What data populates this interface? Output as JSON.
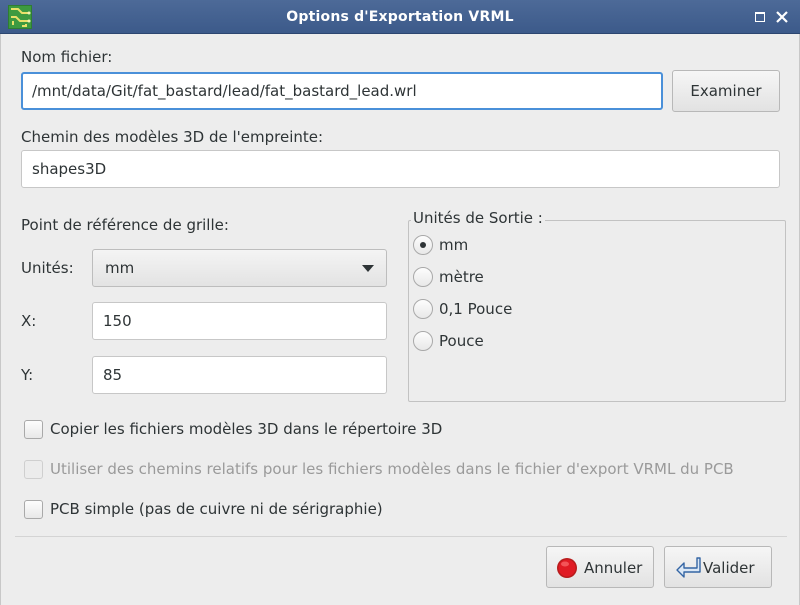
{
  "window": {
    "title": "Options d'Exportation VRML"
  },
  "file": {
    "label": "Nom fichier:",
    "value": "/mnt/data/Git/fat_bastard/lead/fat_bastard_lead.wrl",
    "browse_label": "Examiner"
  },
  "models_path": {
    "label": "Chemin des modèles 3D de l'empreinte:",
    "value": "shapes3D"
  },
  "grid_ref": {
    "label": "Point de référence de grille:",
    "units_label": "Unités:",
    "units_value": "mm",
    "x_label": "X:",
    "x_value": "150",
    "y_label": "Y:",
    "y_value": "85"
  },
  "output_units": {
    "title": "Unités de Sortie :",
    "options": [
      {
        "label": "mm",
        "checked": true
      },
      {
        "label": "mètre",
        "checked": false
      },
      {
        "label": "0,1 Pouce",
        "checked": false
      },
      {
        "label": "Pouce",
        "checked": false
      }
    ]
  },
  "options": {
    "copy_models": {
      "label": "Copier les fichiers modèles 3D dans le répertoire 3D",
      "checked": false,
      "enabled": true
    },
    "relative_paths": {
      "label": "Utiliser des chemins relatifs pour les fichiers modèles dans le fichier d'export VRML du PCB",
      "checked": false,
      "enabled": false
    },
    "simple_pcb": {
      "label": "PCB simple (pas de cuivre ni de sérigraphie)",
      "checked": false,
      "enabled": true
    }
  },
  "buttons": {
    "cancel_label": "Annuler",
    "ok_label": "Valider"
  },
  "colors": {
    "titlebar": "#3c5a8a",
    "focus": "#4a90d9",
    "cancel_icon": "#e01b24"
  },
  "icons": {
    "app": "pcb-icon",
    "maximize": "maximize-icon",
    "close": "close-icon",
    "cancel": "stop-icon",
    "ok": "enter-arrow-icon"
  }
}
